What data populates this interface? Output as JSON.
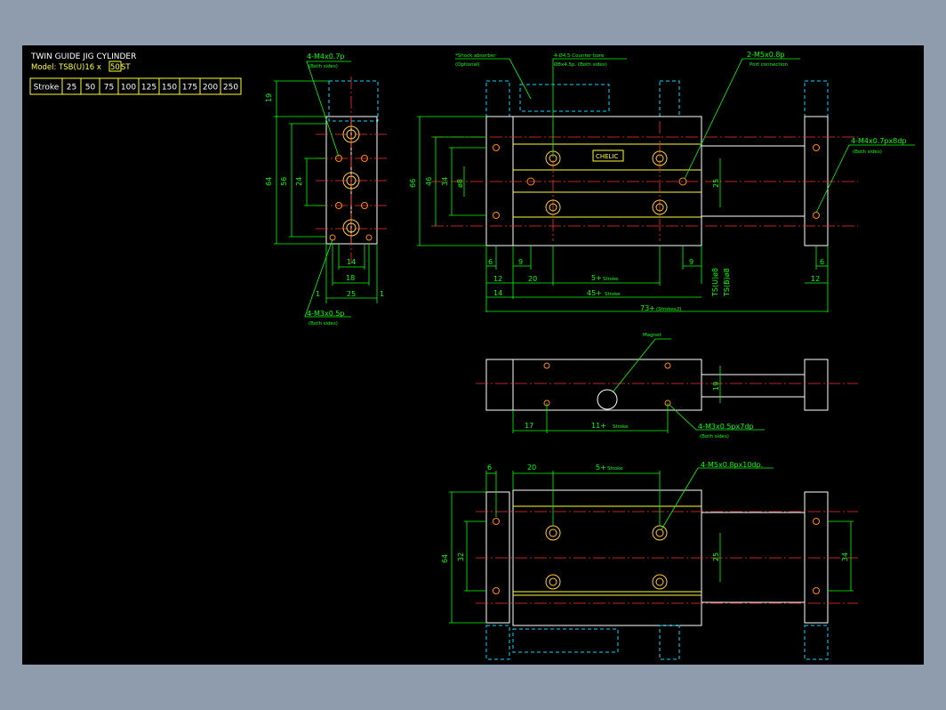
{
  "title_block": {
    "title": "TWIN GUIDE JIG CYLINDER",
    "model_prefix": "Model: TSB(U)16 x ",
    "model_stroke": "50",
    "model_suffix": " ST",
    "stroke_label": "Stroke",
    "strokes": [
      "25",
      "50",
      "75",
      "100",
      "125",
      "150",
      "175",
      "200",
      "250"
    ]
  },
  "side_view": {
    "callout_top": "4-M4x0.7p",
    "callout_top_sub": "(Both sides)",
    "callout_bottom": "4-M3x0.5p",
    "callout_bottom_sub": "(Both sides)",
    "dims": {
      "d19": "19",
      "d64": "64",
      "d56": "56",
      "d24": "24",
      "d14": "14",
      "d18": "18",
      "d25": "25",
      "d1a": "1",
      "d1b": "1"
    }
  },
  "front_view": {
    "shock_label": "*Shock absorber",
    "shock_sub": "(Optional)",
    "bore_label": "4-Ø4.5 Counter bore",
    "bore_sub": "Ø8x4.5p. (Both sides)",
    "port_label": "2-M5x0.8p",
    "port_sub": "Port connection",
    "right_label": "4-M4x0.7px8dp",
    "right_sub": "(Both sides)",
    "logo": "CHELIC",
    "dims": {
      "d66": "66",
      "d46": "46",
      "d34": "34",
      "d8": "ø8",
      "d25": "25",
      "d6": "6",
      "d9a": "9",
      "d9b": "9",
      "d6r": "6",
      "d12": "12",
      "d20": "20",
      "d12r": "12",
      "d14": "14",
      "tsu": "TS(U)ø8",
      "tsb": "TS(B)ø8"
    },
    "dim_stroke_top": {
      "num": "5+",
      "word": "Stroke"
    },
    "dim_stroke_mid": {
      "num": "45+",
      "word": "Stroke"
    },
    "dim_total": {
      "num": "73+",
      "word": "(Strokex2)"
    }
  },
  "mid_view": {
    "magnet_label": "Magnet",
    "hole_label": "4-M3x0.5px7dp",
    "hole_sub": "(Both sides)",
    "d19": "19",
    "d17": "17",
    "dim_stroke": {
      "num": "11+",
      "word": "Stroke"
    }
  },
  "bottom_view": {
    "hole_label": "4-M5x0.8px10dp.",
    "d6": "6",
    "d20": "20",
    "dim_stroke": {
      "num": "5+",
      "word": "Stroke"
    },
    "d64": "64",
    "d32": "32",
    "d25": "25",
    "d34": "34"
  }
}
